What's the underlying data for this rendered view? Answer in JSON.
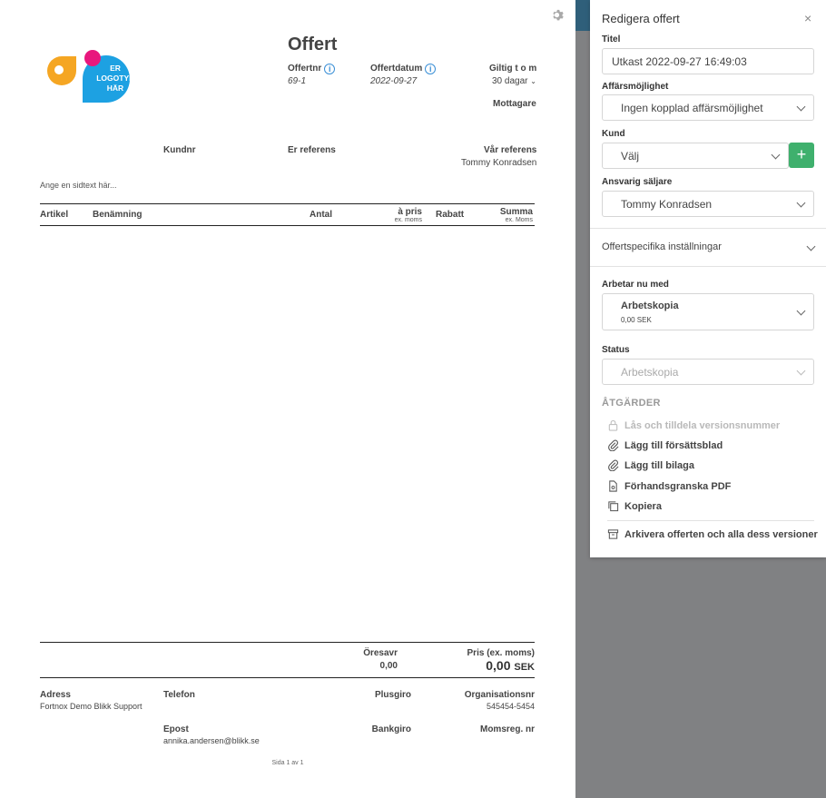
{
  "document": {
    "title": "Offert",
    "offer_number_label": "Offertnr",
    "offer_number": "69-1",
    "offer_date_label": "Offertdatum",
    "offer_date": "2022-09-27",
    "valid_until_label": "Giltig t o m",
    "valid_until_value": "30 dagar",
    "recipient_label": "Mottagare",
    "logo_text": [
      "ER",
      "LOGOTYP",
      "HÄR"
    ],
    "customer_number_label": "Kundnr",
    "your_reference_label": "Er referens",
    "our_reference_label": "Vår referens",
    "our_reference_value": "Tommy Konradsen",
    "sidetext_placeholder": "Ange en sidtext här...",
    "table_headers": {
      "article": "Artikel",
      "description": "Benämning",
      "quantity": "Antal",
      "unit_price": "à pris",
      "unit_price_sub": "ex. moms",
      "discount": "Rabatt",
      "sum": "Summa",
      "sum_sub": "ex. Moms"
    },
    "rounding_label": "Öresavr",
    "rounding_value": "0,00",
    "price_label": "Pris (ex. moms)",
    "price_value": "0,00",
    "price_currency": "SEK",
    "footer": {
      "address_label": "Adress",
      "address_value": "Fortnox Demo Blikk Support",
      "phone_label": "Telefon",
      "plusgiro_label": "Plusgiro",
      "org_label": "Organisationsnr",
      "org_value": "545454-5454",
      "email_label": "Epost",
      "email_value": "annika.andersen@blikk.se",
      "bankgiro_label": "Bankgiro",
      "vat_label": "Momsreg. nr"
    },
    "page_indicator": "Sida 1 av 1"
  },
  "panel": {
    "title": "Redigera offert",
    "close": "×",
    "title_label": "Titel",
    "title_value": "Utkast 2022-09-27 16:49:03",
    "opportunity_label": "Affärsmöjlighet",
    "opportunity_value": "Ingen kopplad affärsmöjlighet",
    "customer_label": "Kund",
    "customer_value": "Välj",
    "add_customer": "+",
    "seller_label": "Ansvarig säljare",
    "seller_value": "Tommy Konradsen",
    "offer_settings": "Offertspecifika inställningar",
    "working_with_label": "Arbetar nu med",
    "working_with_value": "Arbetskopia",
    "working_with_amount": "0,00 SEK",
    "status_label": "Status",
    "status_value": "Arbetskopia",
    "actions_heading": "ÅTGÄRDER",
    "actions": {
      "lock": "Lås och tilldela versionsnummer",
      "cover": "Lägg till försättsblad",
      "attachment": "Lägg till bilaga",
      "preview": "Förhandsgranska PDF",
      "copy": "Kopiera",
      "archive": "Arkivera offerten och alla dess versioner"
    }
  },
  "colors": {
    "accent_green": "#3fb06d",
    "logo_orange": "#f5a623",
    "logo_blue": "#1da1e2",
    "logo_pink": "#e8177d",
    "info_blue": "#3a8fd6",
    "backdrop": "#808183",
    "backdrop_top": "#2f5f7a"
  }
}
